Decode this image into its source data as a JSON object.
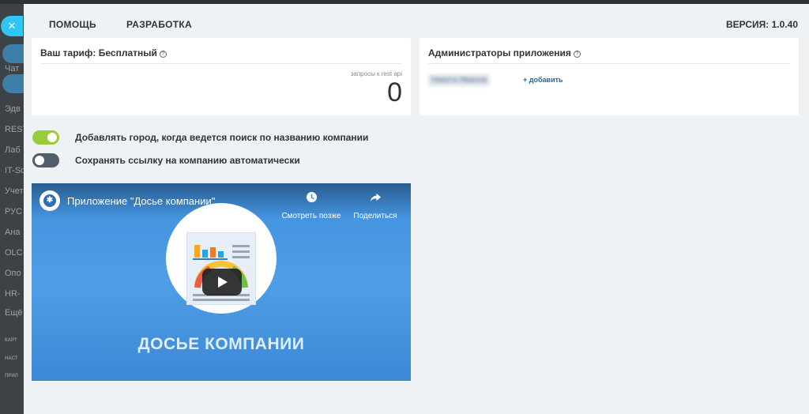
{
  "background": {
    "sidebar_items": [
      "Чат",
      "Эдв",
      "REST",
      "Лаб",
      "IT-Sc",
      "Учет",
      "РУС",
      "Ана",
      "OLC",
      "Опо",
      "HR-",
      "Ещё"
    ],
    "sidebar_small_items": [
      "КАРТ",
      "НАСТ",
      "ПРИЛ"
    ]
  },
  "close_icon": "×",
  "header": {
    "menu": [
      "ПОМОЩЬ",
      "РАЗРАБОТКА"
    ],
    "version": "ВЕРСИЯ: 1.0.40"
  },
  "tariff_card": {
    "title": "Ваш тариф: Бесплатный",
    "help_icon": "?",
    "api_label": "запросы к rest api",
    "api_count": "0"
  },
  "admins_card": {
    "title": "Администраторы приложения",
    "help_icon": "?",
    "admin_name": "Никита Иванов",
    "add_link": "+ добавить"
  },
  "settings": [
    {
      "label": "Добавлять город, когда ведется поиск по названию компании",
      "enabled": true
    },
    {
      "label": "Сохранять ссылку на компанию автоматически",
      "enabled": false
    }
  ],
  "video": {
    "title": "Приложение \"Досье компании\"",
    "watch_later": "Смотреть позже",
    "share": "Поделиться",
    "caption": "ДОСЬЕ КОМПАНИИ",
    "watch_later_icon": "clock-icon",
    "share_icon": "share-arrow-icon"
  },
  "colors": {
    "toggle_on": "#9acb3b",
    "toggle_off": "#535c69",
    "link": "#2067b0",
    "close_button": "#2fc6f6"
  }
}
